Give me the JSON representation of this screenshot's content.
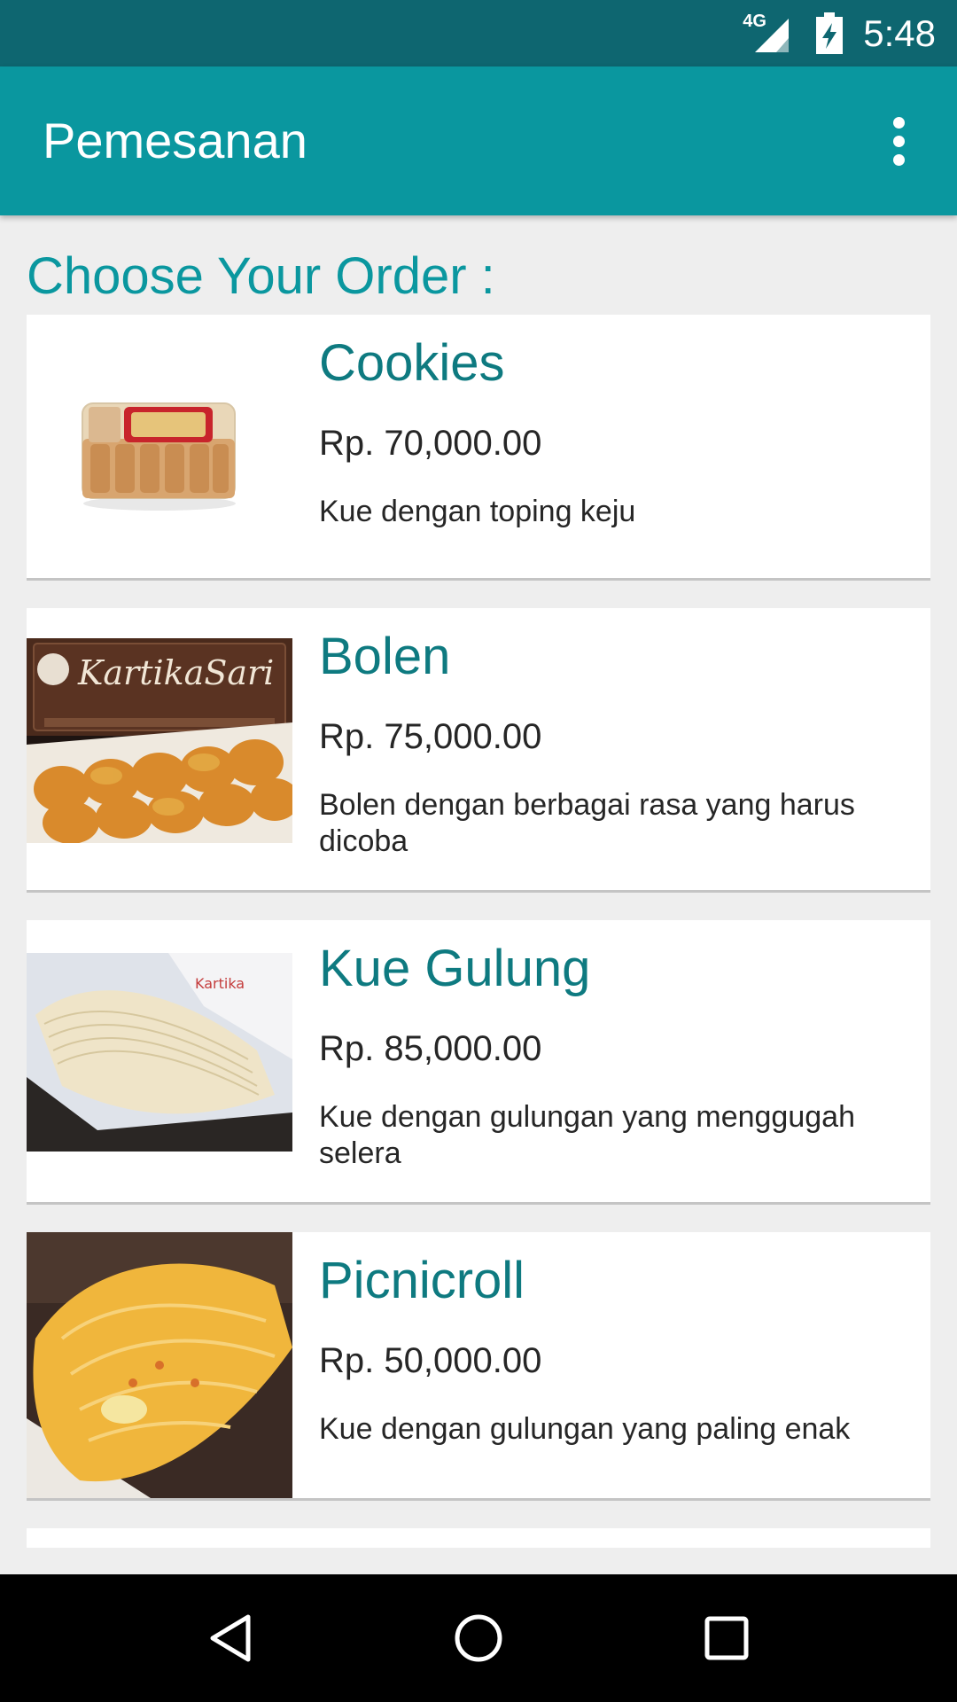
{
  "status_bar": {
    "network": "4G",
    "time": "5:48",
    "icons": [
      "signal-icon",
      "battery-charging-icon"
    ]
  },
  "app_bar": {
    "title": "Pemesanan",
    "menu_icon": "more-vert-icon"
  },
  "section_title": "Choose Your Order :",
  "items": [
    {
      "name": "Cookies",
      "price": "Rp. 70,000.00",
      "description": "Kue dengan toping keju",
      "image": "cookies-image"
    },
    {
      "name": "Bolen",
      "price": "Rp. 75,000.00",
      "description": "Bolen dengan berbagai rasa yang harus dicoba",
      "image": "bolen-image"
    },
    {
      "name": "Kue Gulung",
      "price": "Rp. 85,000.00",
      "description": "Kue dengan gulungan yang menggugah selera",
      "image": "kue-gulung-image"
    },
    {
      "name": "Picnicroll",
      "price": "Rp. 50,000.00",
      "description": "Kue dengan gulungan yang paling enak",
      "image": "picnicroll-image"
    }
  ],
  "nav_bar": {
    "icons": [
      "back-icon",
      "home-icon",
      "recents-icon"
    ]
  },
  "colors": {
    "status_bar": "#0e6670",
    "app_bar": "#0a979f",
    "accent_text": "#0e7a80",
    "background": "#eeeeee"
  }
}
